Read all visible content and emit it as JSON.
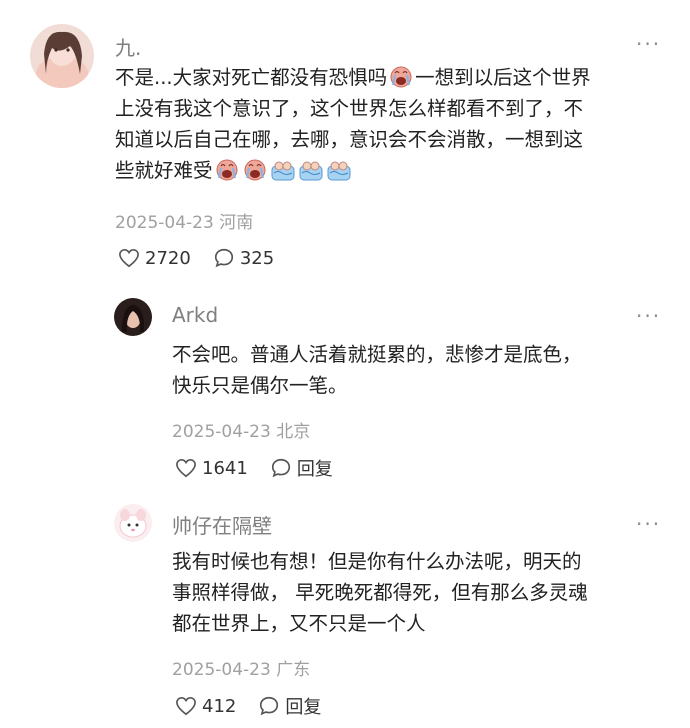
{
  "comments": [
    {
      "author": "九.",
      "lines": [
        "不是...大家对死亡都没有恐惧吗",
        "一想到以后这个世界",
        "上没有我这个意识了，这个世界怎么样都看不到了，不",
        "知道以后自己在哪，去哪，意识会不会消散，一想到这",
        "些就好难受"
      ],
      "emoji": [
        "crying-face-icon",
        "crying-face-icon",
        "crying-face-icon",
        "tear-wave-icon",
        "tear-wave-icon",
        "tear-wave-icon"
      ],
      "date": "2025-04-23",
      "location": "河南",
      "likes": "2720",
      "replies": "325"
    },
    {
      "author": "Arkd",
      "lines": [
        "不会吧。普通人活着就挺累的，悲惨才是底色，",
        "快乐只是偶尔一笔。"
      ],
      "date": "2025-04-23",
      "location": "北京",
      "likes": "1641",
      "reply_label": "回复"
    },
    {
      "author": "帅仔在隔壁",
      "lines": [
        "我有时候也有想！但是你有什么办法呢，明天的",
        "事照样得做， 早死晚死都得死，但有那么多灵魂",
        "都在世界上，又不只是一个人"
      ],
      "date": "2025-04-23",
      "location": "广东",
      "likes": "412",
      "reply_label": "回复"
    }
  ],
  "more_label": "···",
  "colors": {
    "text": "#222222",
    "muted": "#a0a0a0",
    "name": "#7f7f7f"
  }
}
